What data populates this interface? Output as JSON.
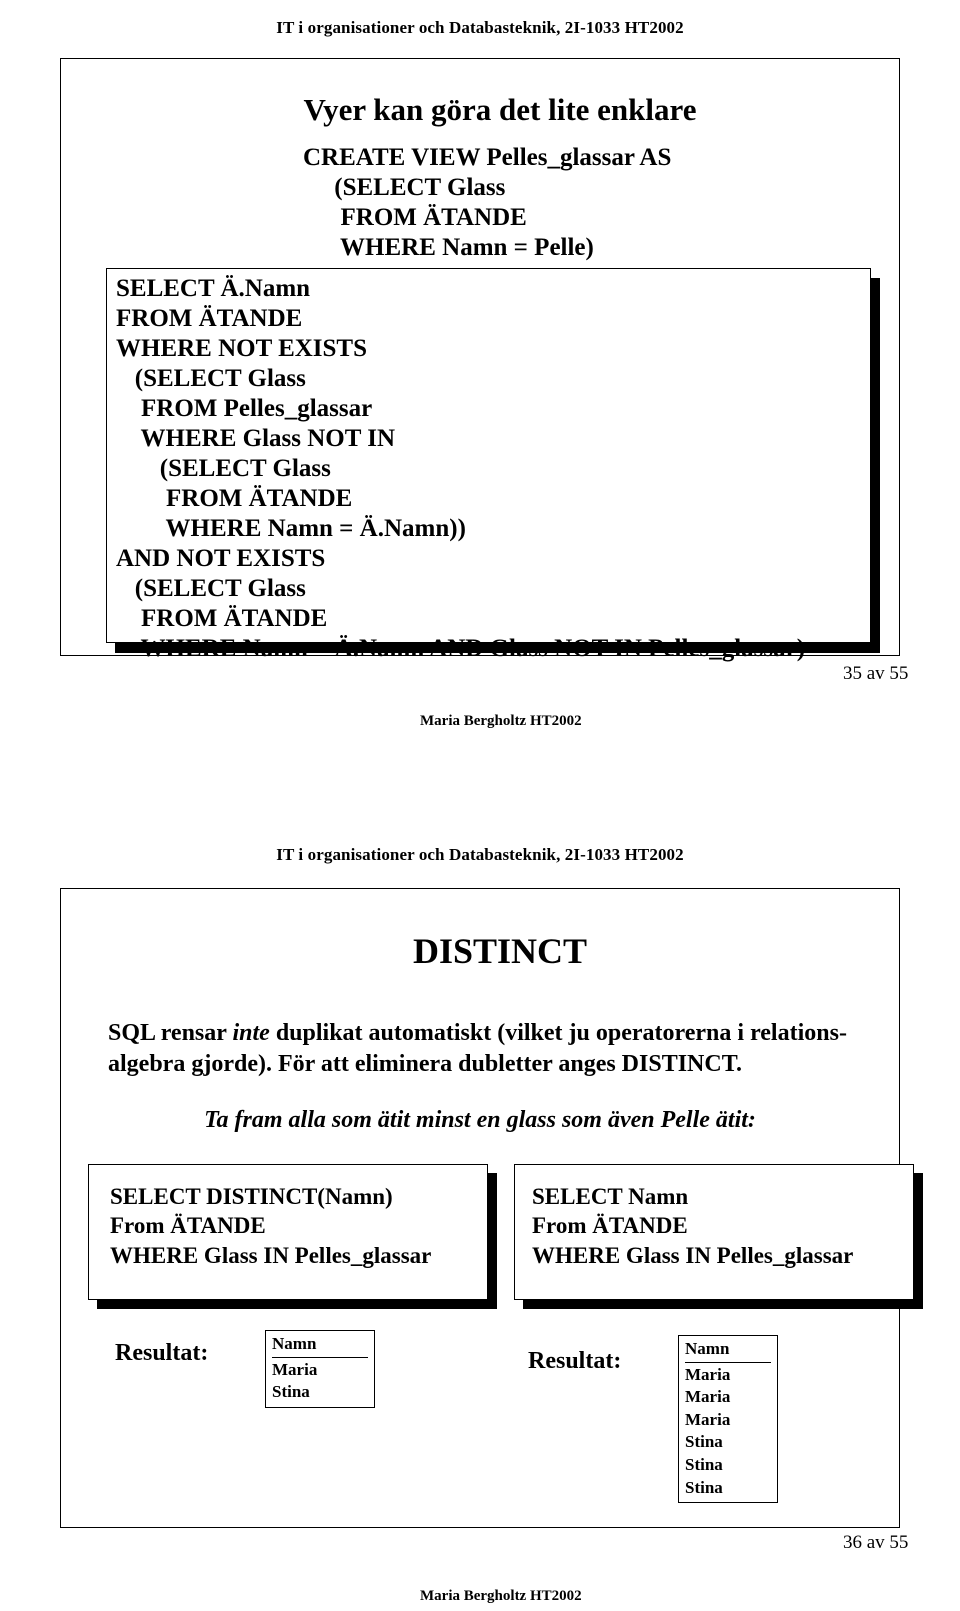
{
  "slide35": {
    "header": "IT i organisationer och Databasteknik, 2I-1033 HT2002",
    "title": "Vyer kan göra det lite enklare",
    "create_view_code": "CREATE VIEW Pelles_glassar AS\n     (SELECT Glass\n      FROM ÄTANDE\n      WHERE Namn = Pelle)",
    "query_code": "SELECT Ä.Namn\nFROM ÄTANDE\nWHERE NOT EXISTS\n   (SELECT Glass\n    FROM Pelles_glassar\n    WHERE Glass NOT IN\n       (SELECT Glass\n        FROM ÄTANDE\n        WHERE Namn = Ä.Namn))\nAND NOT EXISTS\n   (SELECT Glass\n    FROM ÄTANDE\n    WHERE Namn = Ä.Namn AND Glass NOT IN Pelles_glassar)",
    "page_number": "35 av 55",
    "footer": "Maria Bergholtz HT2002"
  },
  "slide36": {
    "header": "IT i organisationer och Databasteknik, 2I-1033 HT2002",
    "title": "DISTINCT",
    "body_line1_pre": "SQL rensar ",
    "body_line1_ital": "inte",
    "body_line1_post": " duplikat automatiskt (vilket ju operatorerna i relations-",
    "body_line2": "algebra gjorde). För att eliminera dubletter anges DISTINCT.",
    "subhead": "Ta fram alla som ätit minst en glass som även Pelle ätit:",
    "sql_left": "SELECT DISTINCT(Namn)\nFrom ÄTANDE\nWHERE Glass IN Pelles_glassar",
    "sql_right": "SELECT Namn\nFrom ÄTANDE\nWHERE Glass IN Pelles_glassar",
    "result_label_left": "Resultat:",
    "result_label_right": "Resultat:",
    "table_left": {
      "header": "Namn",
      "rows": [
        "Maria",
        "Stina"
      ]
    },
    "table_right": {
      "header": "Namn",
      "rows": [
        "Maria",
        "Maria",
        "Maria",
        "Stina",
        "Stina",
        "Stina"
      ]
    },
    "page_number": "36 av 55",
    "footer": "Maria Bergholtz HT2002"
  }
}
